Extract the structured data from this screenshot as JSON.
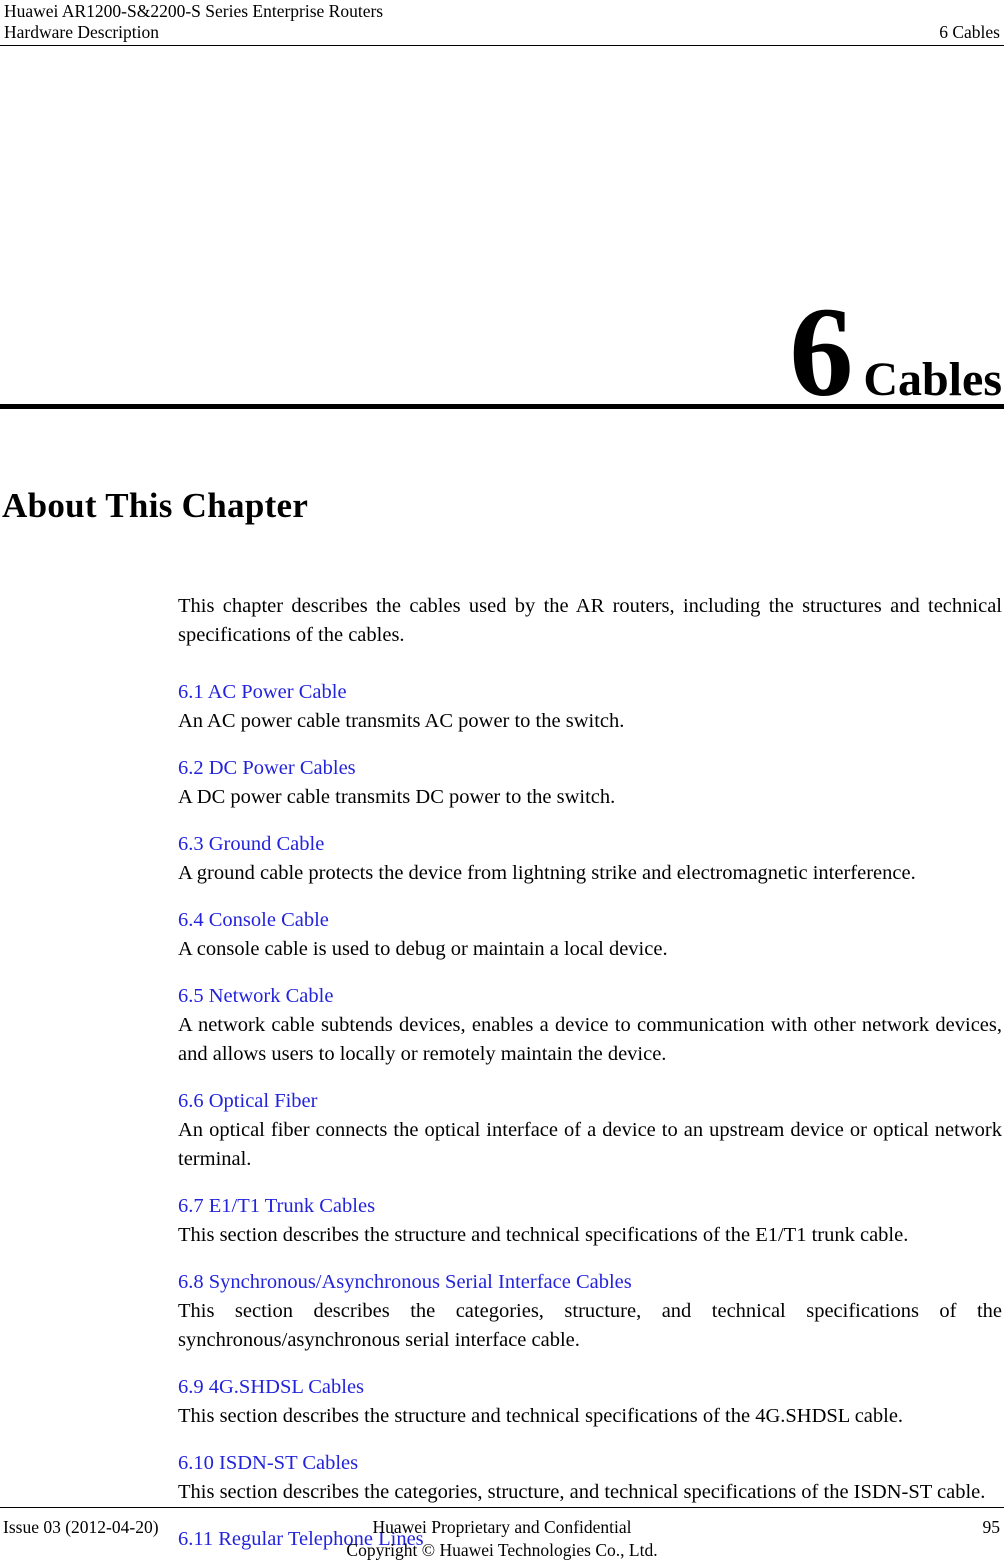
{
  "header": {
    "product_line": "Huawei AR1200-S&2200-S Series Enterprise Routers",
    "document_title": "Hardware Description",
    "chapter_ref": "6 Cables"
  },
  "chapter": {
    "number": "6",
    "name": "Cables"
  },
  "about": {
    "heading": "About This Chapter",
    "intro": "This chapter describes the cables used by the AR routers, including the structures and technical specifications of the cables."
  },
  "sections": [
    {
      "link": "6.1 AC Power Cable",
      "description": "An AC power cable transmits AC power to the switch."
    },
    {
      "link": "6.2 DC Power Cables",
      "description": "A DC power cable transmits DC power to the switch."
    },
    {
      "link": "6.3 Ground Cable",
      "description": "A ground cable protects the device from lightning strike and electromagnetic interference."
    },
    {
      "link": "6.4 Console Cable",
      "description": "A console cable is used to debug or maintain a local device."
    },
    {
      "link": "6.5 Network Cable",
      "description": "A network cable subtends devices, enables a device to communication with other network devices, and allows users to locally or remotely maintain the device."
    },
    {
      "link": "6.6 Optical Fiber",
      "description": "An optical fiber connects the optical interface of a device to an upstream device or optical network terminal."
    },
    {
      "link": "6.7 E1/T1 Trunk Cables",
      "description": "This section describes the structure and technical specifications of the E1/T1 trunk cable."
    },
    {
      "link": "6.8 Synchronous/Asynchronous Serial Interface Cables",
      "description": "This section describes the categories, structure, and technical specifications of the synchronous/asynchronous serial interface cable."
    },
    {
      "link": "6.9 4G.SHDSL Cables",
      "description": "This section describes the structure and technical specifications of the 4G.SHDSL cable."
    },
    {
      "link": "6.10 ISDN-ST Cables",
      "description": "This section describes the categories, structure, and technical specifications of the ISDN-ST cable."
    },
    {
      "link": "6.11 Regular Telephone Lines",
      "description": ""
    }
  ],
  "footer": {
    "issue": "Issue 03 (2012-04-20)",
    "confidentiality": "Huawei Proprietary and Confidential",
    "copyright": "Copyright © Huawei Technologies Co., Ltd.",
    "page_number": "95"
  },
  "colors": {
    "link": "#2323dc",
    "text": "#000000",
    "page_background": "#ffffff"
  }
}
